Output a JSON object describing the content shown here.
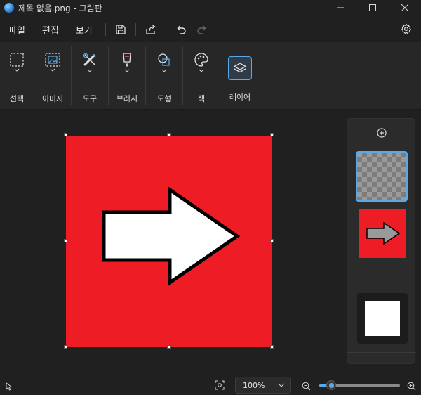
{
  "window": {
    "title": "제목 없음.png - 그림판",
    "minimize_icon": "minimize-icon",
    "maximize_icon": "maximize-icon",
    "close_icon": "close-icon"
  },
  "menu": {
    "items": [
      "파일",
      "편집",
      "보기"
    ],
    "toolbar_icons": [
      "save-icon",
      "share-icon",
      "undo-icon",
      "redo-icon"
    ],
    "settings_icon": "gear-icon"
  },
  "ribbon": {
    "groups": [
      {
        "label": "선택",
        "icon": "selection-icon"
      },
      {
        "label": "이미지",
        "icon": "image-icon"
      },
      {
        "label": "도구",
        "icon": "tools-icon"
      },
      {
        "label": "브러시",
        "icon": "brush-icon"
      },
      {
        "label": "도형",
        "icon": "shapes-icon"
      },
      {
        "label": "색",
        "icon": "palette-icon"
      },
      {
        "label": "레이어",
        "icon": "layers-icon"
      }
    ]
  },
  "canvas": {
    "background_color": "#ee1c24",
    "arrow_fill": "#ffffff",
    "arrow_stroke": "#000000"
  },
  "layers_panel": {
    "add_icon": "add-layer-icon",
    "accent": "#5aa9e6"
  },
  "status": {
    "zoom_label": "100%",
    "zoom_level": 0.15,
    "cursor_icon": "pointer-icon",
    "fit_icon": "fit-screen-icon",
    "zoom_out_icon": "zoom-out-icon",
    "zoom_in_icon": "zoom-in-icon"
  }
}
